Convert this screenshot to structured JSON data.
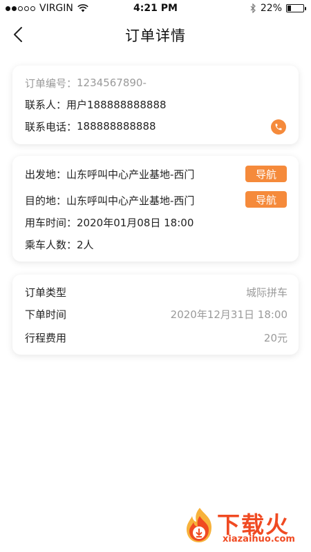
{
  "status_bar": {
    "carrier": "VIRGIN",
    "time": "4:21 PM",
    "battery": "22%",
    "battery_level": 0.22,
    "signal_bars": 2
  },
  "nav": {
    "title": "订单详情",
    "back_icon": "chevron-left-icon"
  },
  "order": {
    "number_label": "订单编号：",
    "number_value": "1234567890-",
    "contact_label": "联系人：",
    "contact_value": "用户188888888888",
    "phone_label": "联系电话：",
    "phone_value": "188888888888",
    "phone_icon": "phone-icon"
  },
  "trip": {
    "departure_label": "出发地：",
    "departure_value": "山东呼叫中心产业基地-西门",
    "destination_label": "目的地：",
    "destination_value": "山东呼叫中心产业基地-西门",
    "navigate_label": "导航",
    "time_label": "用车时间：",
    "time_value": "2020年01月08日  18:00",
    "passengers_label": "乘车人数：",
    "passengers_value": "2人"
  },
  "summary": {
    "type_label": "订单类型",
    "type_value": "城际拼车",
    "order_time_label": "下单时间",
    "order_time_value": "2020年12月31日 18:00",
    "fare_label": "行程费用",
    "fare_value": "20元"
  },
  "watermark": {
    "text": "下载火",
    "sub": "xiazaihuo.com"
  },
  "colors": {
    "accent": "#f58a3b",
    "watermark": "#f04a22",
    "muted": "#9a9a9a"
  }
}
